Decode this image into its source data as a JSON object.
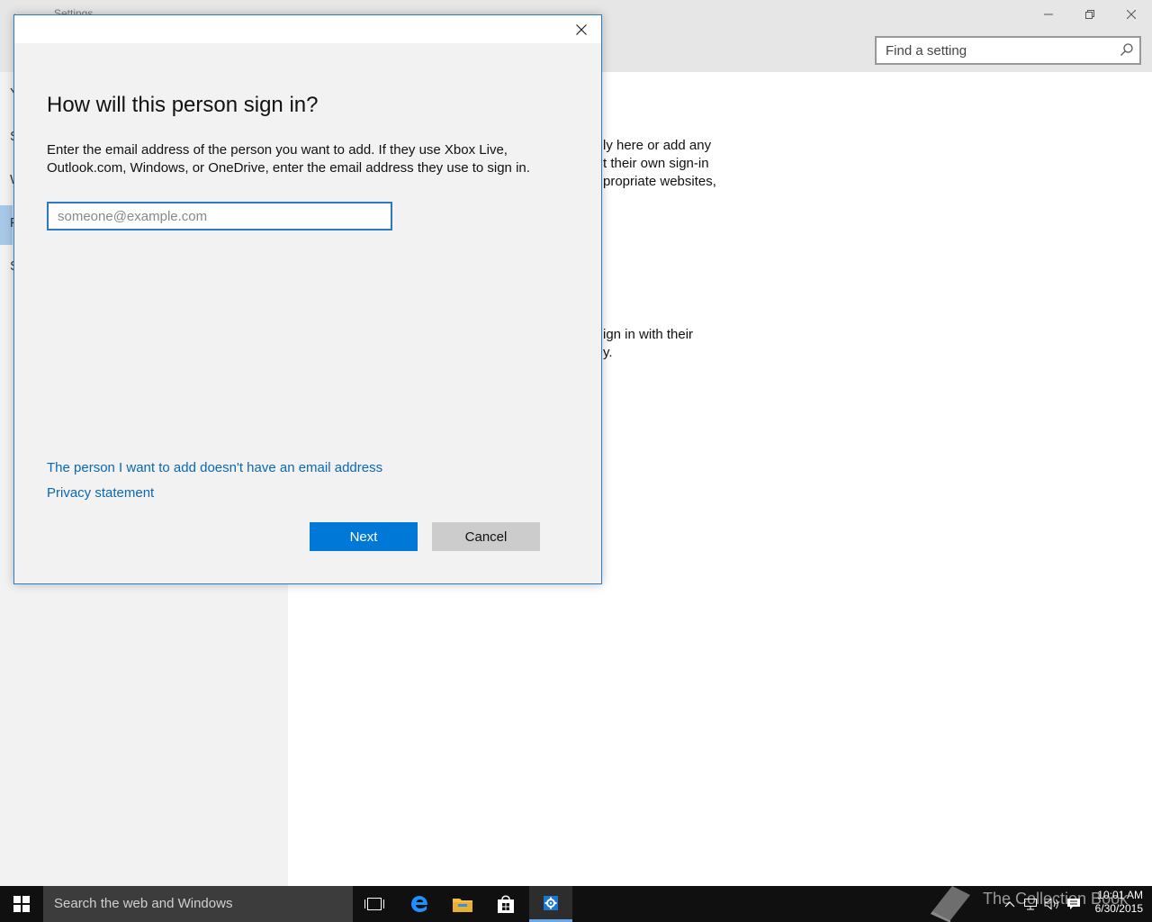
{
  "window": {
    "title": "Settings",
    "search_placeholder": "Find a setting"
  },
  "left_nav": {
    "letters": [
      "Y",
      "S",
      "W",
      "F",
      "S"
    ]
  },
  "content_fragments": [
    "ly here or add any",
    "t their own sign-in",
    "propriate websites,",
    "ign in with their",
    "y."
  ],
  "dialog": {
    "heading": "How will this person sign in?",
    "description": "Enter the email address of the person you want to add. If they use Xbox Live, Outlook.com, Windows, or OneDrive, enter the email address they use to sign in.",
    "email_placeholder": "someone@example.com",
    "link_no_email": "The person I want to add doesn't have an email address",
    "link_privacy": "Privacy statement",
    "next_label": "Next",
    "cancel_label": "Cancel"
  },
  "taskbar": {
    "search_placeholder": "Search the web and Windows",
    "time": "10:01 AM",
    "date": "6/30/2015",
    "watermark": "The Collection Book"
  },
  "colors": {
    "accent": "#0078d7",
    "link": "#0a68b4",
    "dialog_border": "#2b7bc4"
  }
}
